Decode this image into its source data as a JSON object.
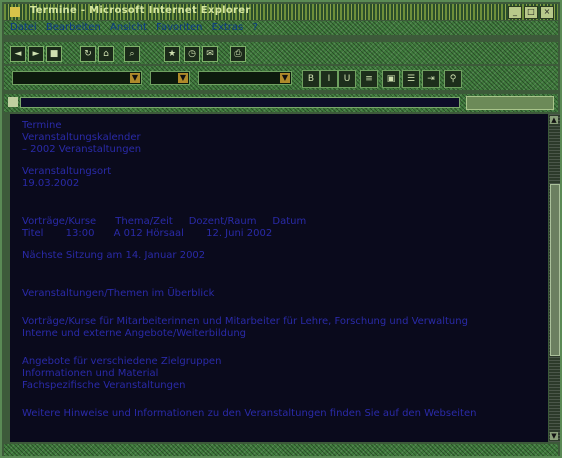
{
  "window": {
    "title": "Termine - Microsoft Internet Explorer"
  },
  "menubar": {
    "items": [
      "Datei",
      "Bearbeiten",
      "Ansicht",
      "Favoriten",
      "Extras",
      "?"
    ]
  },
  "toolbar": {
    "buttons": [
      "back-icon",
      "forward-icon",
      "stop-icon",
      "refresh-icon",
      "home-icon",
      "search-icon",
      "favorites-icon",
      "history-icon",
      "mail-icon",
      "print-icon"
    ]
  },
  "toolbar2": {
    "font_value": "",
    "size_value": "",
    "style_value": ""
  },
  "addressbar": {
    "url": "",
    "go_label": ""
  },
  "content": {
    "lines": [
      "Termine",
      "Veranstaltungskalender",
      "– 2002 Veranstaltungen",
      "",
      "Veranstaltungsort",
      "19.03.2002",
      "",
      "Vorträge/Kurse      Thema/Zeit     Dozent/Raum     Datum",
      "Titel       13:00      A 012 Hörsaal       12. Juni 2002",
      "",
      "Nächste Sitzung am 14. Januar 2002",
      "",
      "Veranstaltungen/Themen im Überblick",
      "",
      "Vorträge/Kurse für Mitarbeiterinnen und Mitarbeiter für Lehre, Forschung und Verwaltung",
      "Interne und externe Angebote/Weiterbildung",
      "",
      "Angebote für verschiedene Zielgruppen",
      "Informationen und Material",
      "Fachspezifische Veranstaltungen",
      "",
      "Weitere Hinweise und Informationen zu den Veranstaltungen finden Sie auf den Webseiten"
    ]
  },
  "statusbar": {
    "text": ""
  },
  "colors": {
    "content_bg": "#0a0a1c",
    "text": "#2a2aa8",
    "chrome": "#3f7a3c"
  }
}
